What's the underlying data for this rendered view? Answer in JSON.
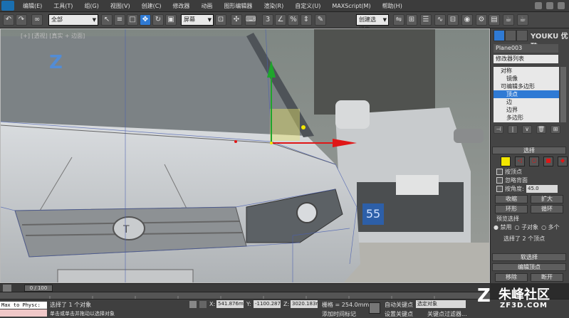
{
  "menu": {
    "items": [
      "编辑(E)",
      "工具(T)",
      "组(G)",
      "视图(V)",
      "创建(C)",
      "修改器",
      "动画",
      "图形编辑器",
      "渲染(R)",
      "自定义(U)",
      "MAXScript(M)",
      "帮助(H)"
    ]
  },
  "toolbar": {
    "filter_value": "全部",
    "reference_coord": "屏幕",
    "named_selection": "创建选择集"
  },
  "viewport": {
    "label": "[+] [透视] [真实 + 边面]",
    "plate_text": "55"
  },
  "command_panel": {
    "object_name": "Plane003",
    "modifier_list": "修改器列表",
    "stack": [
      "对称",
      "镜像",
      "可编辑多边形",
      "顶点",
      "边",
      "边界",
      "多边形",
      "元素"
    ],
    "stack_selected_index": 3,
    "selection_rollout": "选择",
    "by_vertex": "按顶点",
    "ignore_backfacing": "忽略背面",
    "by_angle": "按角度:",
    "angle_value": "45.0",
    "shrink": "收缩",
    "grow": "扩大",
    "ring": "环形",
    "loop": "循环",
    "preview_selection": "预览选择",
    "preview_disabled": "禁用",
    "preview_subobject": "子对象",
    "preview_multi": "多个",
    "selection_info": "选择了 2 个顶点",
    "soft_selection": "软选择",
    "edit_vertices": "编辑顶点",
    "remove": "移除",
    "break": "断开"
  },
  "timeline": {
    "frame": "0 / 100"
  },
  "status": {
    "maxscript": "Max to Physc:",
    "selected": "选择了 1 个对象",
    "prompt": "单击或单击并拖动以选择对象",
    "x_label": "X:",
    "x_value": "541.876mm",
    "y_label": "Y:",
    "y_value": "-1100.287",
    "z_label": "Z:",
    "z_value": "3020.183m",
    "grid": "栅格 = 254.0mm",
    "add_time_tag": "添加时间标记",
    "auto_key": "自动关键点",
    "key_mode": "选定对象",
    "set_key": "设置关键点",
    "key_filters": "关键点过滤器..."
  },
  "watermark": {
    "youku": "YOUKU 优酷",
    "brand": "朱峰社区",
    "url": "ZF3D.COM"
  },
  "colors": {
    "selected_blue": "#2f7ad4",
    "gizmo_green": "#1fa52c",
    "gizmo_red": "#e01616",
    "vertex_yellow": "#f2e600"
  }
}
